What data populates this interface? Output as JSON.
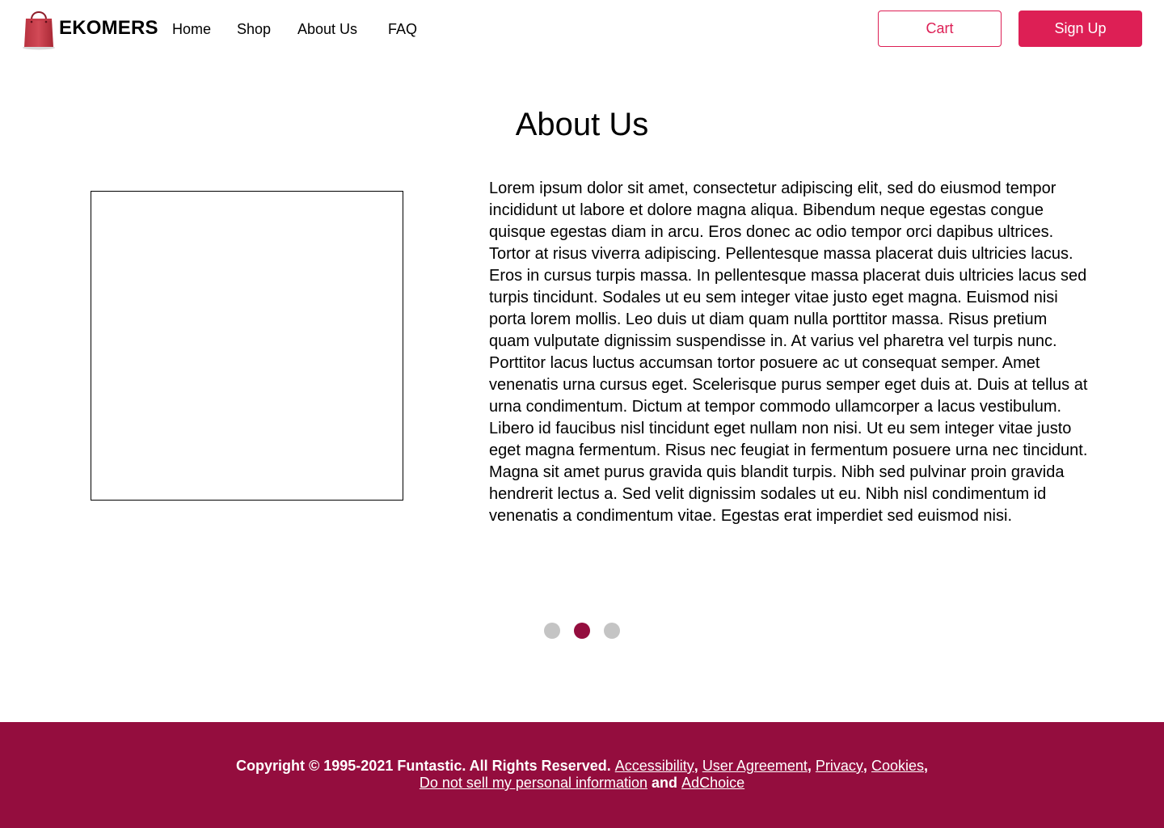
{
  "header": {
    "brand": "EKOMERS",
    "logo_icon": "shopping-bag-icon",
    "nav": {
      "home": "Home",
      "shop": "Shop",
      "about": "About Us",
      "faq": "FAQ"
    },
    "cart_label": "Cart",
    "signup_label": "Sign Up"
  },
  "colors": {
    "accent": "#dd1f55",
    "footer_bg": "#940d3e",
    "dot_active": "#940d3e",
    "dot_inactive": "#c4c4c4"
  },
  "main": {
    "title": "About Us",
    "body": "Lorem ipsum dolor sit amet, consectetur adipiscing elit, sed do eiusmod tempor incididunt ut labore et dolore magna aliqua. Bibendum neque egestas congue quisque egestas diam in arcu. Eros donec ac odio tempor orci dapibus ultrices. Tortor at risus viverra adipiscing. Pellentesque massa placerat duis ultricies lacus. Eros in cursus turpis massa. In pellentesque massa placerat duis ultricies lacus sed turpis tincidunt. Sodales ut eu sem integer vitae justo eget magna. Euismod nisi porta lorem mollis. Leo duis ut diam quam nulla porttitor massa. Risus pretium quam vulputate dignissim suspendisse in. At varius vel pharetra vel turpis nunc. Porttitor lacus luctus accumsan tortor posuere ac ut consequat semper. Amet venenatis urna cursus eget. Scelerisque purus semper eget duis at. Duis at tellus at urna condimentum. Dictum at tempor commodo ullamcorper a lacus vestibulum. Libero id faucibus nisl tincidunt eget nullam non nisi. Ut eu sem integer vitae justo eget magna fermentum. Risus nec feugiat in fermentum posuere urna nec tincidunt. Magna sit amet purus gravida quis blandit turpis. Nibh sed pulvinar proin gravida hendrerit lectus a. Sed velit dignissim sodales ut eu. Nibh nisl condimentum id venenatis a condimentum vitae. Egestas erat imperdiet sed euismod nisi."
  },
  "carousel": {
    "active_index": 2,
    "count": 3
  },
  "footer": {
    "copyright": "Copyright © 1995-2021 Funtastic. All Rights Reserved.",
    "links": {
      "accessibility": "Accessibility",
      "user_agreement": "User Agreement",
      "privacy": "Privacy",
      "cookies": "Cookies",
      "do_not_sell": "Do not sell my personal information",
      "adchoice": "AdChoice"
    },
    "comma": ",",
    "and": "and"
  }
}
